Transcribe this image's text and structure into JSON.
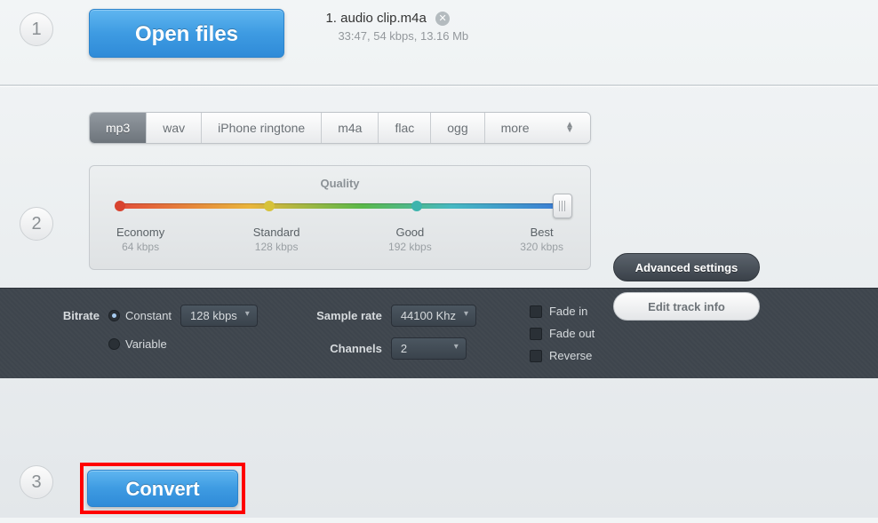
{
  "step1": {
    "num": "1",
    "open_label": "Open files",
    "file_index": "1.",
    "file_name": "audio clip.m4a",
    "file_meta": "33:47, 54 kbps, 13.16 Mb"
  },
  "step2": {
    "num": "2",
    "tabs": {
      "mp3": "mp3",
      "wav": "wav",
      "ringtone": "iPhone ringtone",
      "m4a": "m4a",
      "flac": "flac",
      "ogg": "ogg",
      "more": "more"
    },
    "quality": {
      "title": "Quality",
      "levels": [
        {
          "label": "Economy",
          "sub": "64 kbps"
        },
        {
          "label": "Standard",
          "sub": "128 kbps"
        },
        {
          "label": "Good",
          "sub": "192 kbps"
        },
        {
          "label": "Best",
          "sub": "320 kbps"
        }
      ],
      "selected_label": "Best"
    },
    "side": {
      "advanced": "Advanced settings",
      "edit": "Edit track info"
    },
    "advanced": {
      "bitrate_label": "Bitrate",
      "bitrate_constant": "Constant",
      "bitrate_variable": "Variable",
      "bitrate_value": "128 kbps",
      "samplerate_label": "Sample rate",
      "samplerate_value": "44100 Khz",
      "channels_label": "Channels",
      "channels_value": "2",
      "fadein": "Fade in",
      "fadeout": "Fade out",
      "reverse": "Reverse"
    }
  },
  "step3": {
    "num": "3",
    "convert_label": "Convert"
  }
}
